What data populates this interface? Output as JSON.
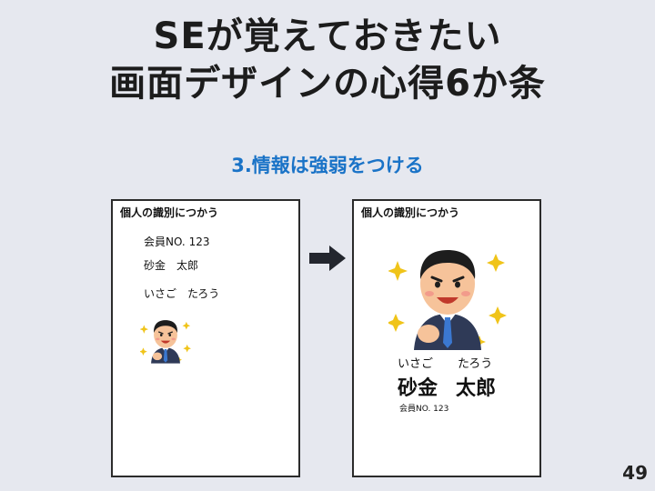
{
  "slide": {
    "title_line1": "SEが覚えておきたい",
    "title_line2": "画面デザインの心得6か条",
    "subtitle": "3.情報は強弱をつける",
    "page_number": "49"
  },
  "left_card": {
    "title": "個人の識別につかう",
    "member_no": "会員NO. 123",
    "name": "砂金　太郎",
    "kana": "いさご　たろう"
  },
  "right_card": {
    "title": "個人の識別につかう",
    "kana_family": "いさご",
    "kana_given": "たろう",
    "name_family": "砂金",
    "name_given": "太郎",
    "member_no": "会員NO. 123"
  },
  "colors": {
    "background": "#e6e8ef",
    "subtitle": "#1a73c7",
    "arrow": "#23262e"
  },
  "icons": [
    "businessman-illustration",
    "sparkle-icon",
    "right-arrow-icon"
  ]
}
